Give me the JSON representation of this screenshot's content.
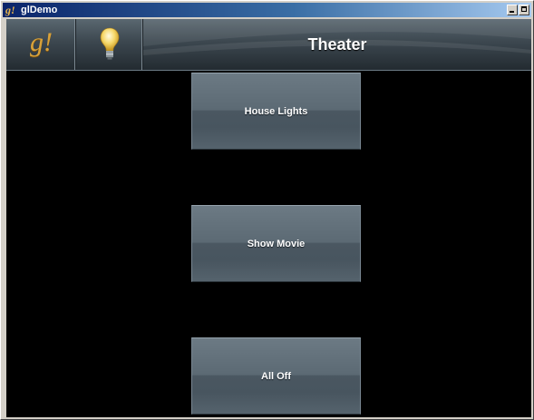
{
  "window": {
    "title": "glDemo",
    "app_icon": "g!",
    "controls": [
      "minimize-icon",
      "maximize-icon"
    ]
  },
  "header": {
    "logo_text": "g!",
    "bulb_icon": "lightbulb-icon",
    "title": "Theater"
  },
  "buttons": [
    {
      "label": "House Lights"
    },
    {
      "label": "Show Movie"
    },
    {
      "label": "All Off"
    }
  ],
  "colors": {
    "background": "#000000",
    "header": "#3c474f",
    "button": "#5c6a74",
    "logo": "#d9a23a",
    "title_text": "#ffffff"
  }
}
